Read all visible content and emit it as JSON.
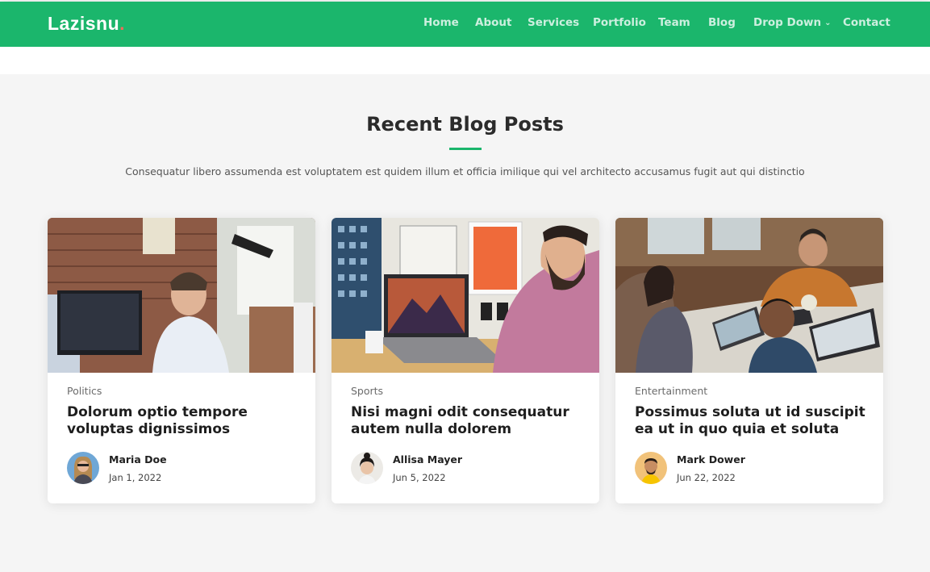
{
  "header": {
    "logo_text": "Lazisnu",
    "logo_dot": ".",
    "nav": [
      "Home",
      "About",
      "Services",
      "Portfolio",
      "Team",
      "Blog",
      "Drop Down",
      "Contact"
    ],
    "colors": {
      "brand": "#1bb66c",
      "logo_dot": "#f06a5a"
    }
  },
  "section": {
    "title": "Recent Blog Posts",
    "subtitle": "Consequatur libero assumenda est voluptatem est quidem illum et officia imilique qui vel architecto accusamus fugit aut qui distinctio"
  },
  "posts": [
    {
      "category": "Politics",
      "title": "Dolorum optio tempore voluptas dignissimos",
      "author": "Maria Doe",
      "date": "Jan 1, 2022"
    },
    {
      "category": "Sports",
      "title": "Nisi magni odit consequatur autem nulla dolorem",
      "author": "Allisa Mayer",
      "date": "Jun 5, 2022"
    },
    {
      "category": "Entertainment",
      "title": "Possimus soluta ut id suscipit ea ut in quo quia et soluta",
      "author": "Mark Dower",
      "date": "Jun 22, 2022"
    }
  ],
  "icons": {
    "dropdown": "chevron-down-icon"
  }
}
